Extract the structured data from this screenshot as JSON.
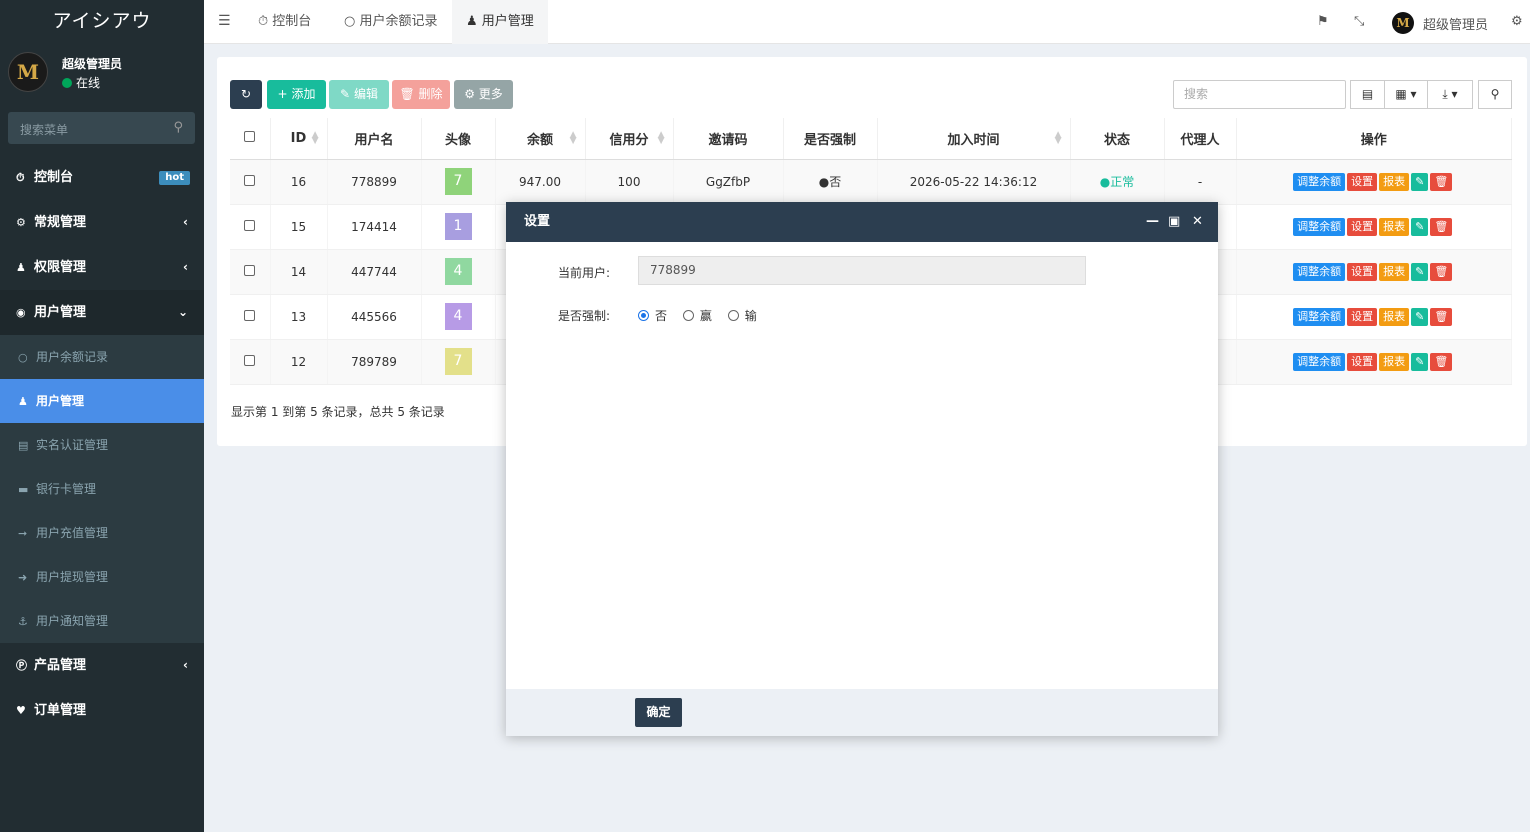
{
  "sidebar": {
    "logo": "アイシアウ",
    "user": {
      "avatar_letter": "M",
      "name": "超级管理员",
      "status": "在线"
    },
    "search_placeholder": "搜索菜单",
    "items": [
      {
        "label": "控制台",
        "icon": "dashboard-icon",
        "badge": "hot"
      },
      {
        "label": "常规管理",
        "icon": "cogs-icon"
      },
      {
        "label": "权限管理",
        "icon": "group-icon"
      },
      {
        "label": "用户管理",
        "icon": "user-circle-icon"
      },
      {
        "label": "用户余额记录",
        "icon": "circle-o-icon"
      },
      {
        "label": "用户管理",
        "icon": "user-icon"
      },
      {
        "label": "实名认证管理",
        "icon": "id-card-icon"
      },
      {
        "label": "银行卡管理",
        "icon": "credit-card-icon"
      },
      {
        "label": "用户充值管理",
        "icon": "sign-in-icon"
      },
      {
        "label": "用户提现管理",
        "icon": "sign-out-icon"
      },
      {
        "label": "用户通知管理",
        "icon": "anchor-icon"
      },
      {
        "label": "产品管理",
        "icon": "product-hunt-icon"
      },
      {
        "label": "订单管理",
        "icon": "heartbeat-icon"
      }
    ]
  },
  "topbar": {
    "tabs": [
      {
        "label": "控制台",
        "icon": "dashboard-icon"
      },
      {
        "label": "用户余额记录",
        "icon": "circle-o-icon"
      },
      {
        "label": "用户管理",
        "icon": "user-icon"
      }
    ],
    "user_name": "超级管理员",
    "avatar_letter": "M"
  },
  "toolbar": {
    "add": "添加",
    "edit": "编辑",
    "delete": "删除",
    "more": "更多",
    "search_placeholder": "搜索"
  },
  "table": {
    "headers": [
      "ID",
      "用户名",
      "头像",
      "余额",
      "信用分",
      "邀请码",
      "是否强制",
      "加入时间",
      "状态",
      "代理人",
      "操作"
    ],
    "rows": [
      {
        "id": "16",
        "username": "778899",
        "avatar": "7",
        "avatar_color": "#8fd37a",
        "balance": "947.00",
        "credit": "100",
        "invite": "GgZfbP",
        "force": "否",
        "joined": "2026-05-22 14:36:12",
        "status": "正常",
        "agent": "-"
      },
      {
        "id": "15",
        "username": "174414",
        "avatar": "1",
        "avatar_color": "#a89ee0"
      },
      {
        "id": "14",
        "username": "447744",
        "avatar": "4",
        "avatar_color": "#90d8a0"
      },
      {
        "id": "13",
        "username": "445566",
        "avatar": "4",
        "avatar_color": "#b79be6"
      },
      {
        "id": "12",
        "username": "789789",
        "avatar": "7",
        "avatar_color": "#e3e08a"
      }
    ],
    "actions": {
      "adjust": "调整余额",
      "settings": "设置",
      "report": "报表"
    },
    "summary": "显示第 1 到第 5 条记录，总共 5 条记录"
  },
  "modal": {
    "title": "设置",
    "current_user_label": "当前用户:",
    "current_user_value": "778899",
    "force_label": "是否强制:",
    "options": [
      "否",
      "赢",
      "输"
    ],
    "selected": "否",
    "confirm": "确定"
  },
  "colors": {
    "sidebar_bg": "#222d32",
    "active_menu": "#4a8ee8",
    "btn_add": "#18bc9c",
    "btn_refresh": "#2c3e50",
    "btn_delete": "#f47b73",
    "btn_more": "#95a5a6",
    "btn_adjust": "#1f8ef1",
    "btn_settings": "#e74c3c",
    "btn_report": "#f39c12",
    "btn_edit": "#18bc9c",
    "btn_del_small": "#e74c3c",
    "status_ok": "#18bc9c"
  }
}
